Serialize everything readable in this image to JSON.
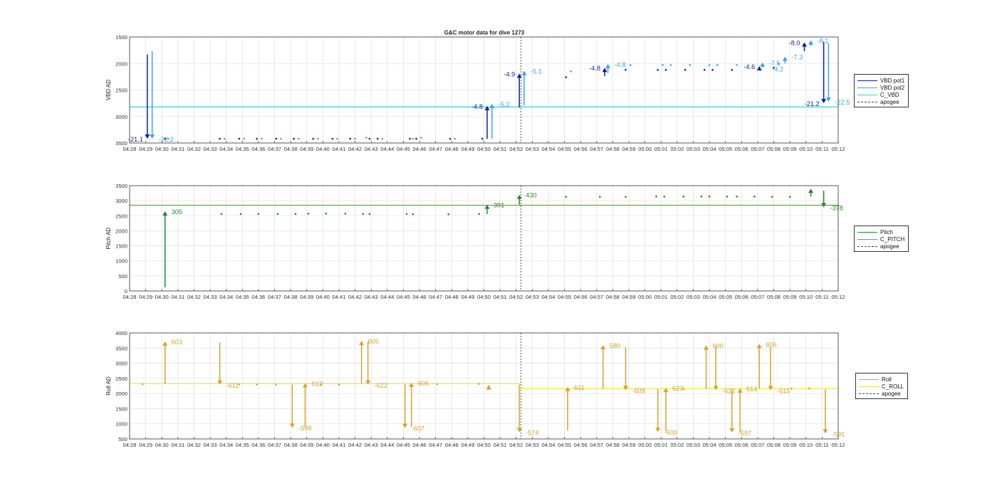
{
  "figure": {
    "title": "G&C motor data for dive 1273"
  },
  "colors": {
    "vbd_pot1": "#0d1f9e",
    "vbd_pot2": "#3fa3e8",
    "c_vbd": "#2fd6e6",
    "pitch": "#23862f",
    "c_pitch": "#3bbf3b",
    "roll": "#d4a42a",
    "c_roll": "#f2e23a",
    "apogee": "#444444",
    "grid": "#e3e3e3",
    "axis": "#333333"
  },
  "time_ticks": [
    "04:28",
    "04:29",
    "04:30",
    "04:31",
    "04:32",
    "04:33",
    "04:34",
    "04:35",
    "04:36",
    "04:37",
    "04:38",
    "04:39",
    "04:40",
    "04:41",
    "04:42",
    "04:43",
    "04:44",
    "04:45",
    "04:46",
    "04:47",
    "04:48",
    "04:49",
    "04:50",
    "04:51",
    "04:52",
    "04:53",
    "04:54",
    "04:55",
    "04:56",
    "04:57",
    "04:58",
    "04:59",
    "05:00",
    "05:01",
    "05:02",
    "05:03",
    "05:04",
    "05:05",
    "05:06",
    "05:07",
    "05:08",
    "05:09",
    "05:10",
    "05:11",
    "05:12"
  ],
  "chart_data": [
    {
      "type": "scatter",
      "ylabel": "VBD AD",
      "xlim": [
        "04:28",
        "05:12"
      ],
      "ylim": [
        1500,
        3500
      ],
      "y_reversed": true,
      "yticks": [
        1500,
        2000,
        2500,
        3000,
        3500
      ],
      "grid": true,
      "apogee_time": "04:52.3",
      "reference_lines": [
        {
          "series": "C_VBD",
          "segments": [
            {
              "from": "04:28",
              "to": "05:12",
              "y": 2820
            }
          ]
        }
      ],
      "points": [
        {
          "series": "VBD pot1",
          "values": [
            [
              "04:30.2",
              3420
            ],
            [
              "04:33.6",
              3420
            ],
            [
              "04:34.8",
              3420
            ],
            [
              "04:35.9",
              3420
            ],
            [
              "04:37.1",
              3420
            ],
            [
              "04:38.2",
              3420
            ],
            [
              "04:39.4",
              3420
            ],
            [
              "04:40.6",
              3420
            ],
            [
              "04:41.7",
              3420
            ],
            [
              "04:42.9",
              3420
            ],
            [
              "04:43.4",
              3420
            ],
            [
              "04:45.4",
              3420
            ],
            [
              "04:45.8",
              3420
            ],
            [
              "04:47.9",
              3420
            ],
            [
              "04:49.9",
              3420
            ],
            [
              "04:55.1",
              2260
            ],
            [
              "04:58.8",
              2120
            ],
            [
              "05:00.8",
              2120
            ],
            [
              "05:01.3",
              2120
            ],
            [
              "05:02.5",
              2120
            ],
            [
              "05:03.7",
              2120
            ],
            [
              "05:04.2",
              2120
            ],
            [
              "05:05.4",
              2120
            ],
            [
              "05:08.0",
              2080
            ]
          ]
        },
        {
          "series": "VBD pot2",
          "values": [
            [
              "04:30.4",
              3420
            ],
            [
              "04:33.9",
              3420
            ],
            [
              "04:35.1",
              3420
            ],
            [
              "04:36.2",
              3420
            ],
            [
              "04:37.4",
              3420
            ],
            [
              "04:38.5",
              3420
            ],
            [
              "04:39.7",
              3420
            ],
            [
              "04:40.9",
              3420
            ],
            [
              "04:42.0",
              3420
            ],
            [
              "04:42.7",
              3400
            ],
            [
              "04:43.7",
              3420
            ],
            [
              "04:45.6",
              3420
            ],
            [
              "04:46.1",
              3400
            ],
            [
              "04:48.2",
              3420
            ],
            [
              "04:55.4",
              2150
            ],
            [
              "04:59.1",
              2030
            ],
            [
              "05:01.1",
              2030
            ],
            [
              "05:01.6",
              2030
            ],
            [
              "05:02.8",
              2030
            ],
            [
              "05:04.0",
              2030
            ],
            [
              "05:04.5",
              2030
            ],
            [
              "05:05.7",
              2030
            ],
            [
              "05:08.3",
              2000
            ]
          ]
        }
      ],
      "events": [
        {
          "series": "VBD pot1",
          "time": "04:29.1",
          "from": 1830,
          "to": 3420,
          "label": "-21.1",
          "label_side": "left"
        },
        {
          "series": "VBD pot2",
          "time": "04:29.4",
          "from": 1770,
          "to": 3420,
          "label": "-22.2",
          "label_side": "right"
        },
        {
          "series": "VBD pot1",
          "time": "04:50.2",
          "from": 3420,
          "to": 2800,
          "label": "-4.8",
          "label_side": "left"
        },
        {
          "series": "VBD pot2",
          "time": "04:50.5",
          "from": 3420,
          "to": 2760,
          "label": "-5.2",
          "label_side": "right"
        },
        {
          "series": "VBD pot1",
          "time": "04:52.2",
          "from": 2830,
          "to": 2190,
          "label": "-4.9",
          "label_side": "left"
        },
        {
          "series": "VBD pot2",
          "time": "04:52.5",
          "from": 2790,
          "to": 2140,
          "label": "-5.1",
          "label_side": "right"
        },
        {
          "series": "VBD pot1",
          "time": "04:57.5",
          "from": 2240,
          "to": 2080,
          "label": "-4.8",
          "label_side": "left"
        },
        {
          "series": "VBD pot2",
          "time": "04:57.7",
          "from": 2180,
          "to": 2010,
          "label": "-4.8",
          "label_side": "right"
        },
        {
          "series": "VBD pot1",
          "time": "05:07.1",
          "from": 2130,
          "to": 2050,
          "label": "-4.6",
          "label_side": "left"
        },
        {
          "series": "VBD pot2",
          "time": "05:07.3",
          "from": 2070,
          "to": 1980,
          "label": "-7.5",
          "label_side": "right"
        },
        {
          "series": "VBD pot2",
          "time": "05:08.7",
          "from": 2000,
          "to": 1870,
          "label": "-7.3",
          "label_side": "right"
        },
        {
          "series": "VBD pot1",
          "time": "05:09.9",
          "from": 1770,
          "to": 1600,
          "label": "-8.0",
          "label_side": "left"
        },
        {
          "series": "VBD pot2",
          "time": "05:10.3",
          "from": 1670,
          "to": 1560,
          "label": "-8.1",
          "label_side": "right"
        },
        {
          "series": "VBD pot1",
          "time": "05:11.1",
          "from": 1590,
          "to": 2750,
          "label": "-21.2",
          "label_side": "left"
        },
        {
          "series": "VBD pot2",
          "time": "05:11.4",
          "from": 1620,
          "to": 2720,
          "label": "-22.5",
          "label_side": "right"
        }
      ],
      "extra_labels": [
        {
          "series": "VBD pot2",
          "time": "05:07.9",
          "y": 2110,
          "text": "-4.2"
        }
      ],
      "legend": {
        "position": "right",
        "entries": [
          "VBD pot1",
          "VBD pot2",
          "C_VBD",
          "apogee"
        ]
      }
    },
    {
      "type": "scatter",
      "ylabel": "Pitch AD",
      "xlim": [
        "04:28",
        "05:12"
      ],
      "ylim": [
        0,
        3500
      ],
      "yticks": [
        0,
        500,
        1000,
        1500,
        2000,
        2500,
        3000,
        3500
      ],
      "grid": true,
      "apogee_time": "04:52.3",
      "reference_lines": [
        {
          "series": "C_PITCH",
          "segments": [
            {
              "from": "04:28",
              "to": "05:12",
              "y": 2850
            }
          ]
        }
      ],
      "points": [
        {
          "series": "Pitch",
          "values": [
            [
              "04:33.7",
              2560
            ],
            [
              "04:34.9",
              2560
            ],
            [
              "04:36.0",
              2560
            ],
            [
              "04:37.2",
              2560
            ],
            [
              "04:38.3",
              2560
            ],
            [
              "04:39.1",
              2570
            ],
            [
              "04:40.2",
              2570
            ],
            [
              "04:41.4",
              2570
            ],
            [
              "04:42.5",
              2560
            ],
            [
              "04:42.9",
              2560
            ],
            [
              "04:45.2",
              2560
            ],
            [
              "04:45.6",
              2550
            ],
            [
              "04:47.8",
              2550
            ],
            [
              "04:49.7",
              2560
            ],
            [
              "04:55.1",
              3130
            ],
            [
              "04:57.2",
              3130
            ],
            [
              "04:58.8",
              3130
            ],
            [
              "05:00.7",
              3140
            ],
            [
              "05:01.2",
              3140
            ],
            [
              "05:02.4",
              3140
            ],
            [
              "05:03.5",
              3140
            ],
            [
              "05:04.0",
              3140
            ],
            [
              "05:05.1",
              3140
            ],
            [
              "05:05.7",
              3140
            ],
            [
              "05:06.8",
              3140
            ],
            [
              "05:07.9",
              3130
            ],
            [
              "05:09.0",
              3130
            ]
          ]
        }
      ],
      "events": [
        {
          "series": "Pitch",
          "time": "04:30.2",
          "from": 120,
          "to": 2650,
          "label": "305",
          "label_side": "right"
        },
        {
          "series": "Pitch",
          "time": "04:50.2",
          "from": 2560,
          "to": 2870,
          "label": "391",
          "label_side": "right"
        },
        {
          "series": "Pitch",
          "time": "04:52.2",
          "from": 2870,
          "to": 3200,
          "label": "430",
          "label_side": "right"
        },
        {
          "series": "Pitch",
          "time": "05:10.3",
          "from": 3140,
          "to": 3400,
          "label": "",
          "label_side": "right"
        },
        {
          "series": "Pitch",
          "time": "05:11.1",
          "from": 3330,
          "to": 2780,
          "label": "-378",
          "label_side": "right"
        }
      ],
      "legend": {
        "position": "right",
        "entries": [
          "Pitch",
          "C_PITCH",
          "apogee"
        ]
      }
    },
    {
      "type": "scatter",
      "ylabel": "Roll AD",
      "xlim": [
        "04:28",
        "05:12"
      ],
      "ylim": [
        500,
        4000
      ],
      "yticks": [
        500,
        1000,
        1500,
        2000,
        2500,
        3000,
        3500,
        4000
      ],
      "grid": true,
      "apogee_time": "04:52.3",
      "reference_lines": [
        {
          "series": "C_ROLL",
          "segments": [
            {
              "from": "04:28",
              "to": "04:52.3",
              "y": 2330
            },
            {
              "from": "04:52.3",
              "to": "05:12",
              "y": 2160
            }
          ]
        }
      ],
      "points": [
        {
          "series": "Roll",
          "values": [
            [
              "04:28.8",
              2310
            ],
            [
              "04:34.8",
              2300
            ],
            [
              "04:35.9",
              2300
            ],
            [
              "04:37.1",
              2300
            ],
            [
              "04:39.9",
              2300
            ],
            [
              "04:41.0",
              2290
            ],
            [
              "04:47.1",
              2310
            ],
            [
              "04:49.7",
              2320
            ],
            [
              "05:02.4",
              2150
            ],
            [
              "05:09.1",
              2160
            ],
            [
              "05:10.2",
              2170
            ]
          ]
        }
      ],
      "events": [
        {
          "series": "Roll",
          "time": "04:30.2",
          "from": 2320,
          "to": 3720,
          "label": "603",
          "label_side": "right"
        },
        {
          "series": "Roll",
          "time": "04:33.6",
          "from": 3690,
          "to": 2290,
          "label": "-611",
          "label_side": "right"
        },
        {
          "series": "Roll",
          "time": "04:38.1",
          "from": 2300,
          "to": 870,
          "label": "-598",
          "label_side": "right"
        },
        {
          "series": "Roll",
          "time": "04:38.9",
          "from": 880,
          "to": 2340,
          "label": "612",
          "label_side": "right"
        },
        {
          "series": "Roll",
          "time": "04:42.4",
          "from": 2320,
          "to": 3740,
          "label": "605",
          "label_side": "right"
        },
        {
          "series": "Roll",
          "time": "04:42.8",
          "from": 3710,
          "to": 2290,
          "label": "-622",
          "label_side": "right"
        },
        {
          "series": "Roll",
          "time": "04:45.1",
          "from": 2300,
          "to": 860,
          "label": "-607",
          "label_side": "right"
        },
        {
          "series": "Roll",
          "time": "04:45.5",
          "from": 900,
          "to": 2360,
          "label": "606",
          "label_side": "right"
        },
        {
          "series": "Roll",
          "time": "04:52.2",
          "from": 2300,
          "to": 720,
          "label": "-574",
          "label_side": "right"
        },
        {
          "series": "Roll",
          "time": "04:55.2",
          "from": 780,
          "to": 2220,
          "label": "611",
          "label_side": "right"
        },
        {
          "series": "Roll",
          "time": "04:57.4",
          "from": 2160,
          "to": 3600,
          "label": "580",
          "label_side": "right"
        },
        {
          "series": "Roll",
          "time": "04:58.8",
          "from": 3530,
          "to": 2110,
          "label": "-609",
          "label_side": "right"
        },
        {
          "series": "Roll",
          "time": "05:00.8",
          "from": 2150,
          "to": 730,
          "label": "-600",
          "label_side": "right"
        },
        {
          "series": "Roll",
          "time": "05:01.3",
          "from": 750,
          "to": 2190,
          "label": "623",
          "label_side": "right"
        },
        {
          "series": "Roll",
          "time": "05:03.8",
          "from": 2150,
          "to": 3590,
          "label": "600",
          "label_side": "right"
        },
        {
          "series": "Roll",
          "time": "05:04.4",
          "from": 3560,
          "to": 2110,
          "label": "-622",
          "label_side": "right"
        },
        {
          "series": "Roll",
          "time": "05:05.4",
          "from": 2140,
          "to": 710,
          "label": "-597",
          "label_side": "right"
        },
        {
          "series": "Roll",
          "time": "05:05.9",
          "from": 720,
          "to": 2170,
          "label": "614",
          "label_side": "right"
        },
        {
          "series": "Roll",
          "time": "05:07.1",
          "from": 2170,
          "to": 3640,
          "label": "606",
          "label_side": "right"
        },
        {
          "series": "Roll",
          "time": "05:07.8",
          "from": 3550,
          "to": 2110,
          "label": "-615",
          "label_side": "right"
        },
        {
          "series": "Roll",
          "time": "05:11.2",
          "from": 2140,
          "to": 680,
          "label": "-591",
          "label_side": "right"
        }
      ],
      "markers": [
        {
          "series": "Roll",
          "time": "04:50.3",
          "y": 2200,
          "marker": "triangle-up"
        }
      ],
      "legend": {
        "position": "right",
        "entries": [
          "Roll",
          "C_ROLL",
          "apogee"
        ]
      }
    }
  ]
}
